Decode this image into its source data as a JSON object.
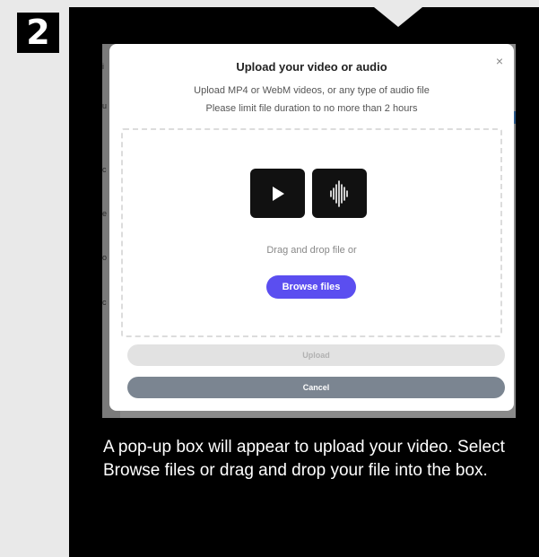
{
  "step": {
    "number": "2"
  },
  "modal": {
    "title": "Upload your video or audio",
    "subtitle_line1": "Upload MP4 or WebM videos, or any type of audio file",
    "subtitle_line2": "Please limit file duration to no more than 2 hours",
    "close_label": "×",
    "dropzone": {
      "icons": [
        "play-icon",
        "audio-waveform-icon"
      ],
      "prompt": "Drag and drop file or",
      "browse_label": "Browse files"
    },
    "upload_label": "Upload",
    "cancel_label": "Cancel",
    "colors": {
      "browse": "#5b4ef0",
      "upload_disabled": "#e2e2e2",
      "cancel": "#7b8591"
    }
  },
  "caption": "A pop-up box will appear to upload your video. Select Browse files or drag and drop your file into the box."
}
